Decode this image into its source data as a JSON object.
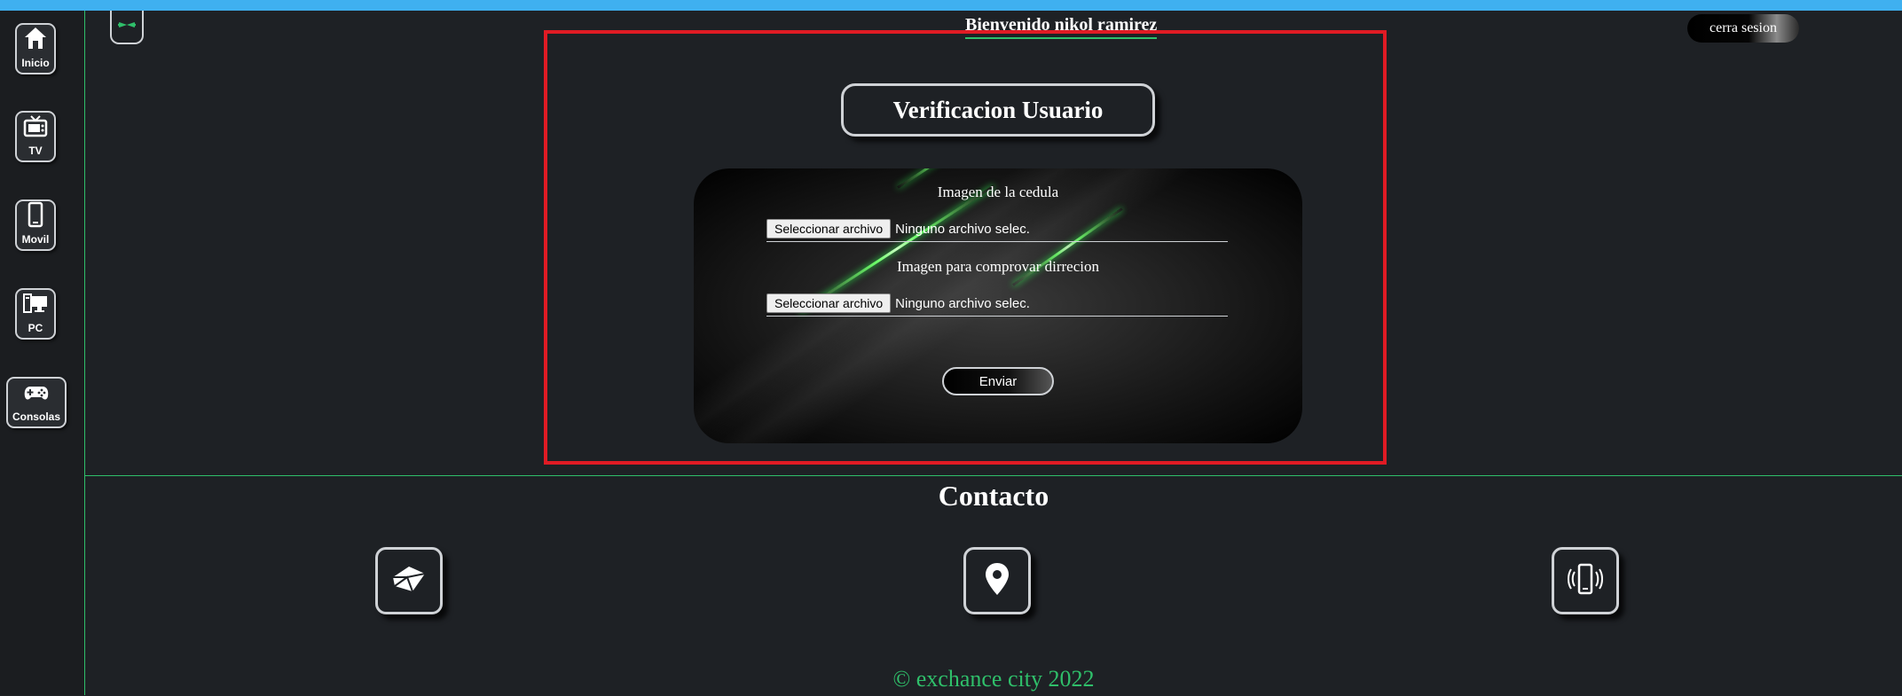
{
  "sidebar": {
    "items": [
      {
        "label": "Inicio",
        "icon": "home-icon"
      },
      {
        "label": "TV",
        "icon": "tv-icon"
      },
      {
        "label": "Movil",
        "icon": "mobile-icon"
      },
      {
        "label": "PC",
        "icon": "pc-icon"
      },
      {
        "label": "Consolas",
        "icon": "gamepad-icon"
      }
    ]
  },
  "header": {
    "welcome": "Bienvenido nikol ramirez",
    "logout_label": "cerra sesion"
  },
  "verification": {
    "title": "Verificacion Usuario",
    "fields": [
      {
        "label": "Imagen de la cedula",
        "button": "Seleccionar archivo",
        "status": "Ninguno archivo selec."
      },
      {
        "label": "Imagen para comprovar dirrecion",
        "button": "Seleccionar archivo",
        "status": "Ninguno archivo selec."
      }
    ],
    "submit_label": "Enviar"
  },
  "contact": {
    "title": "Contacto",
    "icons": [
      "envelope-icon",
      "location-pin-icon",
      "phone-vibrate-icon"
    ],
    "copyright": "© exchance city 2022"
  },
  "colors": {
    "accent_green": "#2fbf6a",
    "highlight_red": "#e01b24",
    "top_bar_blue": "#3fb0f0",
    "background": "#1e2125"
  }
}
